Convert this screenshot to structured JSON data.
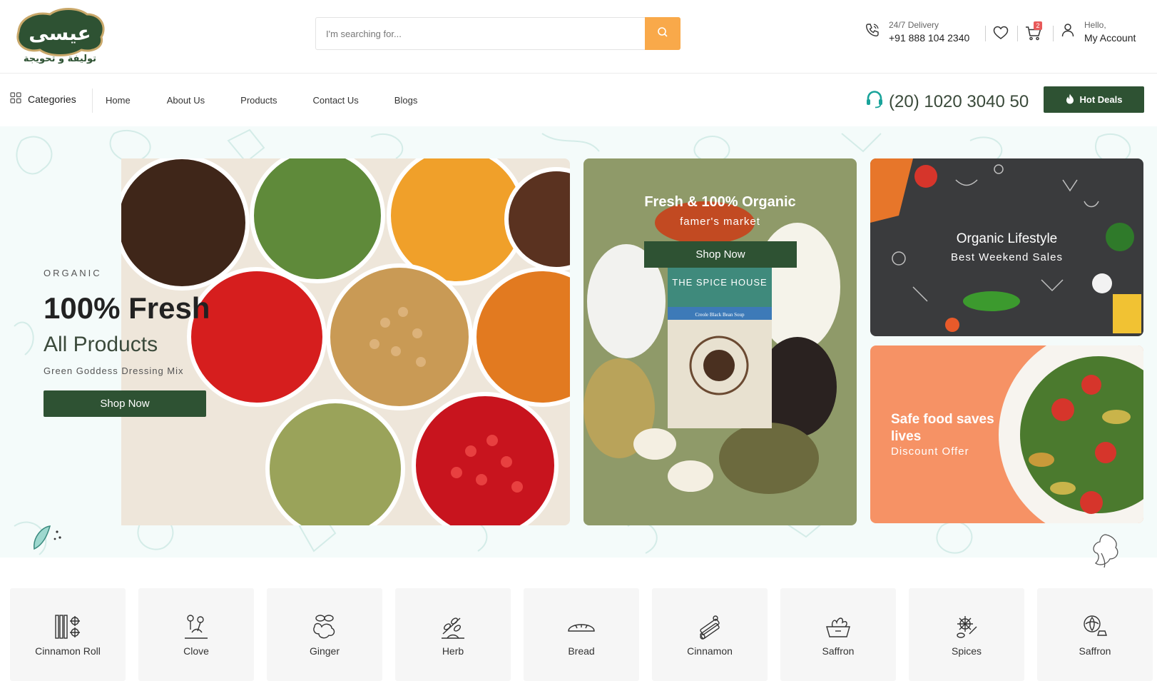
{
  "brand": {
    "logo_text": "عيسى",
    "logo_tagline": "توليفة و تحويجة"
  },
  "search": {
    "placeholder": "I'm searching for..."
  },
  "header": {
    "delivery_label": "24/7 Delivery",
    "delivery_phone": "+91 888 104 2340",
    "cart_count": "2",
    "account_greeting": "Hello,",
    "account_label": "My Account"
  },
  "nav": {
    "categories_label": "Categories",
    "links": [
      "Home",
      "About Us",
      "Products",
      "Contact Us",
      "Blogs"
    ],
    "support_phone": "(20) 1020 3040 50",
    "hot_deals_label": "Hot Deals"
  },
  "hero": {
    "eyebrow": "ORGANIC",
    "title": "100% Fresh",
    "subtitle": "All Products",
    "description": "Green Goddess Dressing Mix",
    "button": "Shop Now"
  },
  "promo_middle": {
    "title": "Fresh & 100% Organic",
    "subtitle": "famer's market",
    "button": "Shop Now",
    "package_brand": "THE SPICE HOUSE",
    "package_label": "Creole Black Bean Soup"
  },
  "promo_top_right": {
    "title": "Organic Lifestyle",
    "subtitle": "Best Weekend Sales"
  },
  "promo_bottom_right": {
    "title": "Safe food saves lives",
    "subtitle": "Discount Offer"
  },
  "categories": [
    {
      "label": "Cinnamon Roll",
      "icon": "cinnamon-roll-icon"
    },
    {
      "label": "Clove",
      "icon": "clove-icon"
    },
    {
      "label": "Ginger",
      "icon": "ginger-icon"
    },
    {
      "label": "Herb",
      "icon": "herb-icon"
    },
    {
      "label": "Bread",
      "icon": "bread-icon"
    },
    {
      "label": "Cinnamon",
      "icon": "cinnamon-icon"
    },
    {
      "label": "Saffron",
      "icon": "saffron-icon"
    },
    {
      "label": "Spices",
      "icon": "spices-icon"
    },
    {
      "label": "Saffron",
      "icon": "saffron-icon"
    }
  ],
  "colors": {
    "brand_green": "#2e5233",
    "search_orange": "#f9a94a",
    "support_teal": "#19a39a",
    "promo_orange": "#f69265",
    "promo_dark": "#3a3b3d",
    "promo_olive": "#8f9a69"
  }
}
